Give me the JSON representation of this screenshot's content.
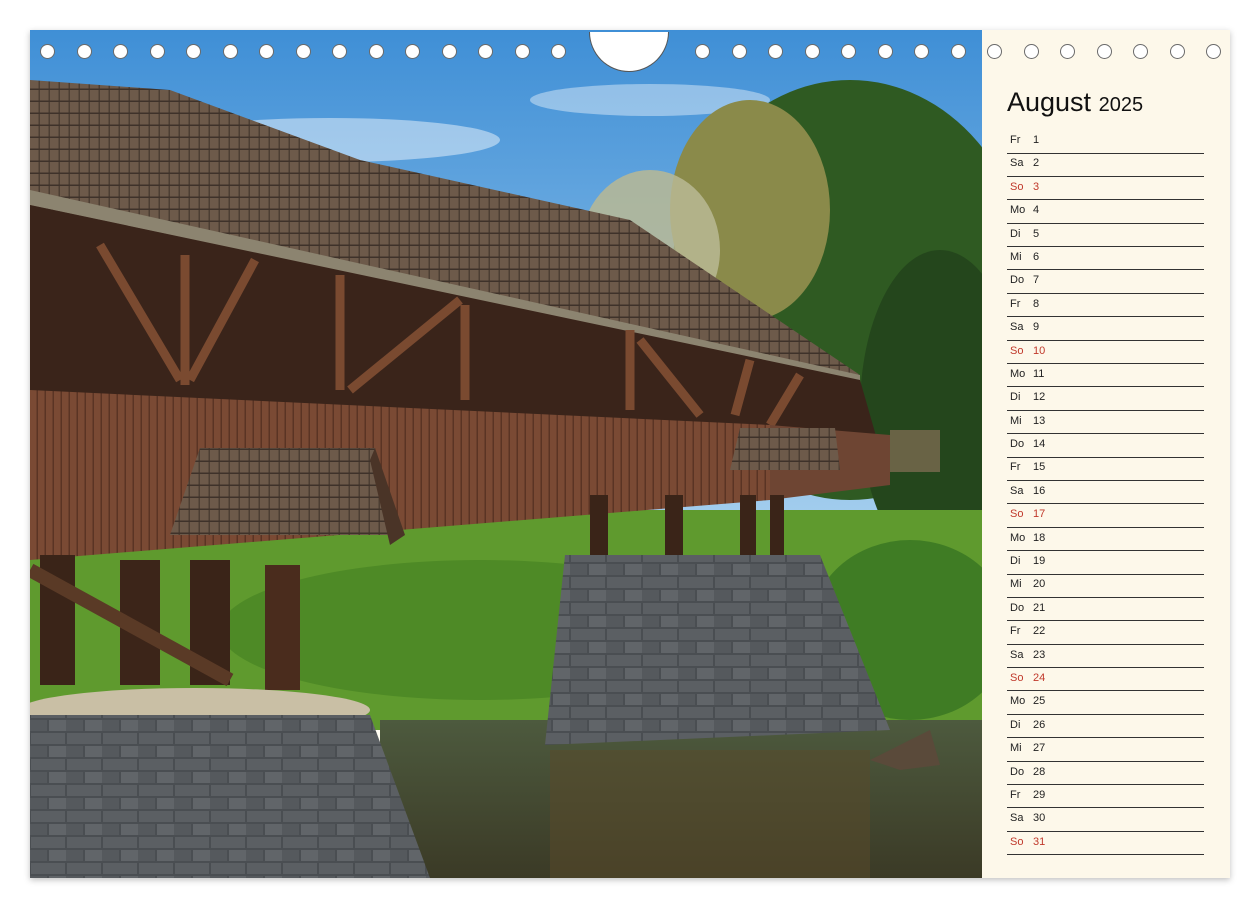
{
  "calendar": {
    "month": "August",
    "year": "2025",
    "days": [
      {
        "wd": "Fr",
        "d": "1",
        "sunday": false
      },
      {
        "wd": "Sa",
        "d": "2",
        "sunday": false
      },
      {
        "wd": "So",
        "d": "3",
        "sunday": true
      },
      {
        "wd": "Mo",
        "d": "4",
        "sunday": false
      },
      {
        "wd": "Di",
        "d": "5",
        "sunday": false
      },
      {
        "wd": "Mi",
        "d": "6",
        "sunday": false
      },
      {
        "wd": "Do",
        "d": "7",
        "sunday": false
      },
      {
        "wd": "Fr",
        "d": "8",
        "sunday": false
      },
      {
        "wd": "Sa",
        "d": "9",
        "sunday": false
      },
      {
        "wd": "So",
        "d": "10",
        "sunday": true
      },
      {
        "wd": "Mo",
        "d": "11",
        "sunday": false
      },
      {
        "wd": "Di",
        "d": "12",
        "sunday": false
      },
      {
        "wd": "Mi",
        "d": "13",
        "sunday": false
      },
      {
        "wd": "Do",
        "d": "14",
        "sunday": false
      },
      {
        "wd": "Fr",
        "d": "15",
        "sunday": false
      },
      {
        "wd": "Sa",
        "d": "16",
        "sunday": false
      },
      {
        "wd": "So",
        "d": "17",
        "sunday": true
      },
      {
        "wd": "Mo",
        "d": "18",
        "sunday": false
      },
      {
        "wd": "Di",
        "d": "19",
        "sunday": false
      },
      {
        "wd": "Mi",
        "d": "20",
        "sunday": false
      },
      {
        "wd": "Do",
        "d": "21",
        "sunday": false
      },
      {
        "wd": "Fr",
        "d": "22",
        "sunday": false
      },
      {
        "wd": "Sa",
        "d": "23",
        "sunday": false
      },
      {
        "wd": "So",
        "d": "24",
        "sunday": true
      },
      {
        "wd": "Mo",
        "d": "25",
        "sunday": false
      },
      {
        "wd": "Di",
        "d": "26",
        "sunday": false
      },
      {
        "wd": "Mi",
        "d": "27",
        "sunday": false
      },
      {
        "wd": "Do",
        "d": "28",
        "sunday": false
      },
      {
        "wd": "Fr",
        "d": "29",
        "sunday": false
      },
      {
        "wd": "Sa",
        "d": "30",
        "sunday": false
      },
      {
        "wd": "So",
        "d": "31",
        "sunday": true
      }
    ]
  },
  "colors": {
    "sunday": "#c0392b",
    "weekday": "#222222",
    "panel": "#fdf8ea"
  }
}
